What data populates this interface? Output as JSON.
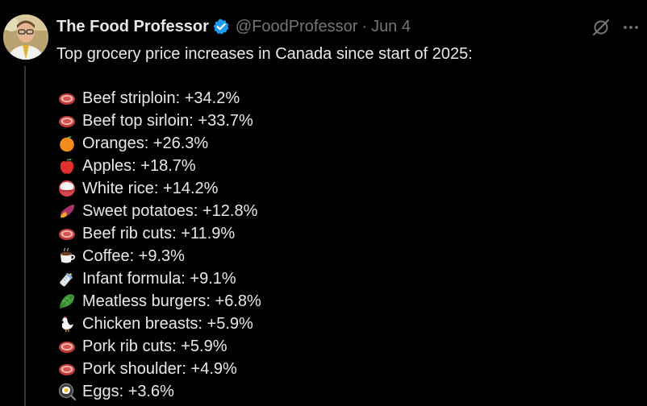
{
  "author": {
    "display_name": "The Food Professor",
    "handle": "@FoodProfessor",
    "separator": "·",
    "date": "Jun 4",
    "verified_color": "#1d9bf0"
  },
  "actions": {
    "grok_icon": "grok-icon",
    "more_icon": "more-options-icon"
  },
  "post": {
    "headline": "Top grocery price increases in Canada since start of 2025:",
    "items": [
      {
        "icon": "steak-icon",
        "text": "Beef striploin: +34.2%"
      },
      {
        "icon": "steak-icon",
        "text": "Beef top sirloin: +33.7%"
      },
      {
        "icon": "orange-icon",
        "text": "Oranges: +26.3%"
      },
      {
        "icon": "apple-icon",
        "text": "Apples: +18.7%"
      },
      {
        "icon": "rice-icon",
        "text": "White rice: +14.2%"
      },
      {
        "icon": "sweet-potato-icon",
        "text": "Sweet potatoes: +12.8%"
      },
      {
        "icon": "steak-icon",
        "text": "Beef rib cuts: +11.9%"
      },
      {
        "icon": "coffee-icon",
        "text": "Coffee: +9.3%"
      },
      {
        "icon": "baby-bottle-icon",
        "text": "Infant formula: +9.1%"
      },
      {
        "icon": "leafy-green-icon",
        "text": "Meatless burgers: +6.8%"
      },
      {
        "icon": "rooster-icon",
        "text": "Chicken breasts: +5.9%"
      },
      {
        "icon": "steak-icon",
        "text": "Pork rib cuts: +5.9%"
      },
      {
        "icon": "steak-icon",
        "text": "Pork shoulder: +4.9%"
      },
      {
        "icon": "fried-egg-icon",
        "text": "Eggs: +3.6%"
      }
    ]
  },
  "colors": {
    "background": "#000000",
    "text": "#e7e9ea",
    "muted": "#71767b",
    "thread_line": "#333639"
  }
}
